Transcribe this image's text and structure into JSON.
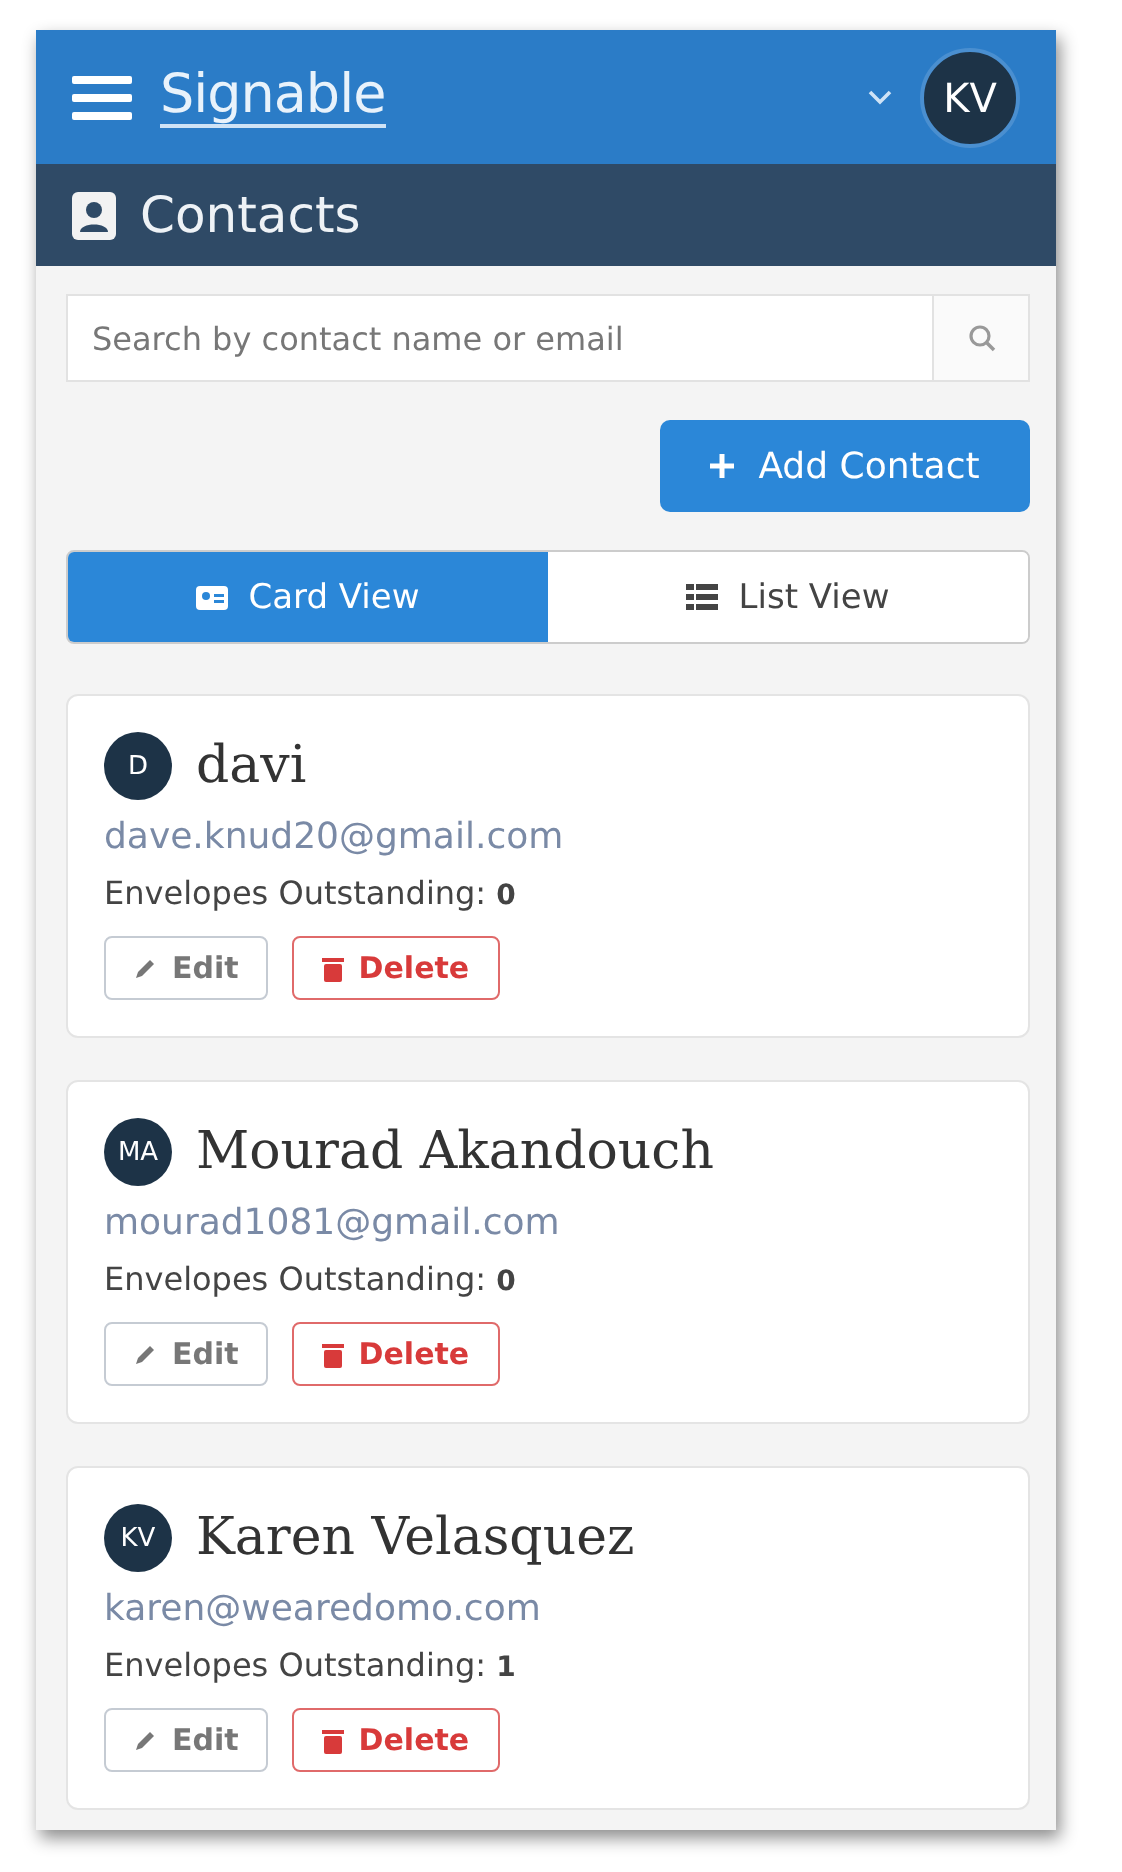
{
  "header": {
    "logo": "Signable",
    "user_initials": "KV"
  },
  "page_title": "Contacts",
  "search": {
    "placeholder": "Search by contact name or email"
  },
  "add_button": "Add Contact",
  "view_tabs": [
    {
      "label": "Card View",
      "kind": "card",
      "selected": true
    },
    {
      "label": "List View",
      "kind": "list",
      "selected": false
    }
  ],
  "contacts": [
    {
      "initials": "D",
      "name": "davi",
      "email": "dave.knud20@gmail.com",
      "outstanding_label": "Envelopes Outstanding:",
      "outstanding": "0",
      "edit": "Edit",
      "delete": "Delete"
    },
    {
      "initials": "MA",
      "name": "Mourad Akandouch",
      "email": "mourad1081@gmail.com",
      "outstanding_label": "Envelopes Outstanding:",
      "outstanding": "0",
      "edit": "Edit",
      "delete": "Delete"
    },
    {
      "initials": "KV",
      "name": "Karen Velasquez",
      "email": "karen@wearedomo.com",
      "outstanding_label": "Envelopes Outstanding:",
      "outstanding": "1",
      "edit": "Edit",
      "delete": "Delete"
    }
  ]
}
